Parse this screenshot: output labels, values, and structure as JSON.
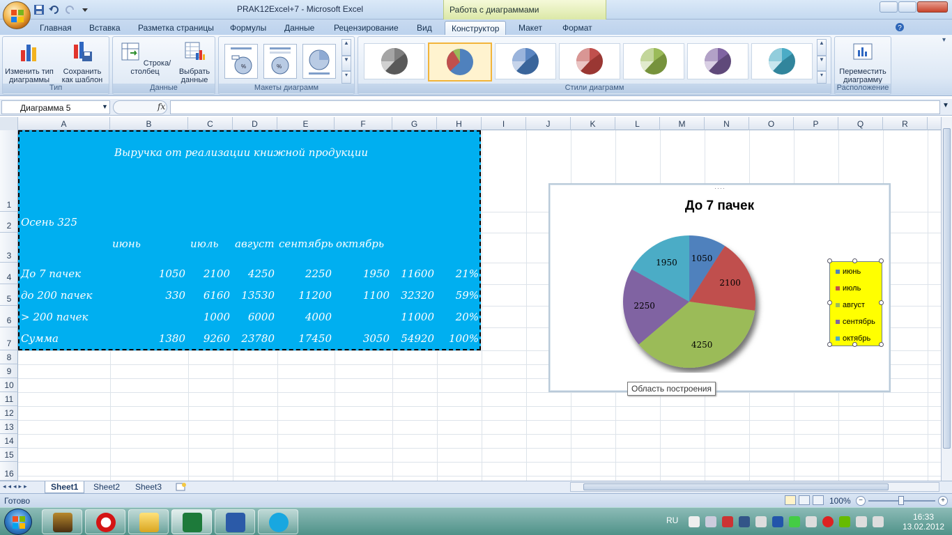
{
  "window": {
    "title": "PRAK12Excel+7 - Microsoft Excel",
    "context_title": "Работа с диаграммами"
  },
  "tabs": [
    "Главная",
    "Вставка",
    "Разметка страницы",
    "Формулы",
    "Данные",
    "Рецензирование",
    "Вид",
    "Конструктор",
    "Макет",
    "Формат"
  ],
  "active_tab": "Конструктор",
  "ribbon": {
    "type_group": {
      "label": "Тип",
      "change_type": "Изменить тип диаграммы",
      "save_template": "Сохранить как шаблон"
    },
    "data_group": {
      "label": "Данные",
      "switch_row_col": "Строка/столбец",
      "select_data": "Выбрать данные"
    },
    "layouts_group": {
      "label": "Макеты диаграмм"
    },
    "styles_group": {
      "label": "Стили диаграмм"
    },
    "location_group": {
      "label": "Расположение",
      "move_chart": "Переместить диаграмму"
    }
  },
  "formula_bar": {
    "name_box": "Диаграмма 5",
    "fx": "fx",
    "formula": ""
  },
  "columns": [
    "A",
    "B",
    "C",
    "D",
    "E",
    "F",
    "G",
    "H",
    "I",
    "J",
    "K",
    "L",
    "M",
    "N",
    "O",
    "P",
    "Q",
    "R"
  ],
  "rows": [
    "1",
    "2",
    "3",
    "4",
    "5",
    "6",
    "7",
    "8",
    "9",
    "10",
    "11",
    "12",
    "13",
    "14",
    "15",
    "16"
  ],
  "sheet": {
    "r1_title": "Выручка от реализации книжной продукции",
    "r2_label": "Осень 325",
    "r3_headers": [
      "июнь",
      "июль",
      "август",
      "сентябрь",
      "октябрь"
    ],
    "table": [
      {
        "label": "До 7 пачек",
        "b": "1050",
        "c": "2100",
        "d": "4250",
        "e": "2250",
        "f": "1950",
        "g": "11600",
        "h": "21%"
      },
      {
        "label": "до 200 пачек",
        "b": "330",
        "c": "6160",
        "d": "13530",
        "e": "11200",
        "f": "1100",
        "g": "32320",
        "h": "59%"
      },
      {
        "label": "> 200 пачек",
        "b": "",
        "c": "1000",
        "d": "6000",
        "e": "4000",
        "f": "",
        "g": "11000",
        "h": "20%"
      },
      {
        "label": "Сумма",
        "b": "1380",
        "c": "9260",
        "d": "23780",
        "e": "17450",
        "f": "3050",
        "g": "54920",
        "h": "100%"
      }
    ]
  },
  "chart_data": {
    "type": "pie",
    "title": "До 7 пачек",
    "categories": [
      "июнь",
      "июль",
      "август",
      "сентябрь",
      "октябрь"
    ],
    "values": [
      1050,
      2100,
      4250,
      2250,
      1950
    ],
    "colors": [
      "#4f81bd",
      "#c0504d",
      "#9bbb59",
      "#8064a2",
      "#4bacc6"
    ],
    "legend": "right"
  },
  "tooltip": "Область построения",
  "sheet_tabs": [
    "Sheet1",
    "Sheet2",
    "Sheet3"
  ],
  "active_sheet": "Sheet1",
  "status": {
    "text": "Готово",
    "zoom": "100%"
  },
  "taskbar": {
    "lang": "RU",
    "time": "16:33",
    "date": "13.02.2012"
  }
}
